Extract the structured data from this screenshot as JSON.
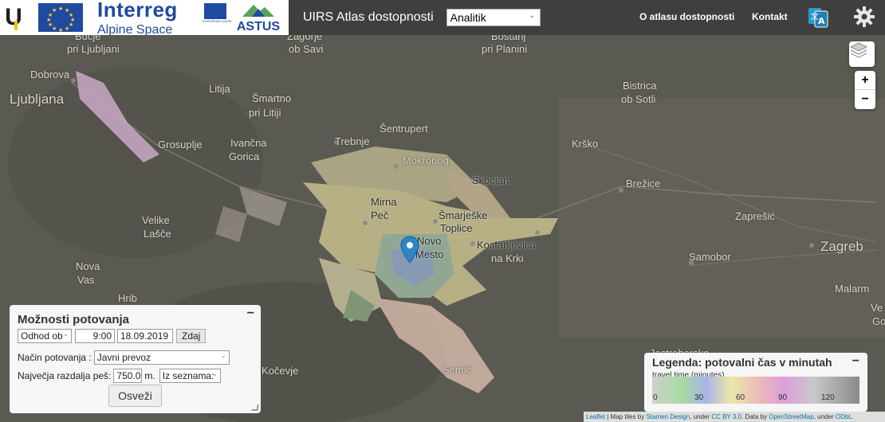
{
  "header": {
    "logo_letter": "U",
    "interreg_title": "Interreg",
    "interreg_subtitle": "Alpine Space",
    "eu_small_text": "EUROPEAN UNION",
    "astus_label": "ASTUS",
    "app_title": "UIRS Atlas dostopnosti",
    "mode_value": "Analitik",
    "nav_about": "O atlasu dostopnosti",
    "nav_contact": "Kontakt",
    "icons": [
      "translate-icon",
      "gear-icon"
    ]
  },
  "map": {
    "places": [
      {
        "name": "Bučje",
        "dark": false
      },
      {
        "name": "pri Ljubljani",
        "dark": false
      },
      {
        "name": "Zagorje",
        "dark": false
      },
      {
        "name": "ob Savi",
        "dark": false
      },
      {
        "name": "Boštanj",
        "dark": false
      },
      {
        "name": "pri Planini",
        "dark": false
      },
      {
        "name": "Dobrova",
        "dark": false
      },
      {
        "name": "Ljubljana",
        "dark": false
      },
      {
        "name": "Litija",
        "dark": false
      },
      {
        "name": "Šmartno",
        "dark": false
      },
      {
        "name": "pri Litiji",
        "dark": false
      },
      {
        "name": "Bistrica",
        "dark": false
      },
      {
        "name": "ob Sotli",
        "dark": false
      },
      {
        "name": "Šentrupert",
        "dark": false
      },
      {
        "name": "Grosuplje",
        "dark": false
      },
      {
        "name": "Ivančna",
        "dark": false
      },
      {
        "name": "Gorica",
        "dark": false
      },
      {
        "name": "Trebnje",
        "dark": false
      },
      {
        "name": "Mokronog",
        "dark": false
      },
      {
        "name": "Krško",
        "dark": false
      },
      {
        "name": "Škocjan",
        "dark": true
      },
      {
        "name": "Brežice",
        "dark": false
      },
      {
        "name": "Mirna",
        "dark": true
      },
      {
        "name": "Peč",
        "dark": true
      },
      {
        "name": "Šmarješke",
        "dark": true
      },
      {
        "name": "Toplice",
        "dark": true
      },
      {
        "name": "Velike",
        "dark": false
      },
      {
        "name": "Lašče",
        "dark": false
      },
      {
        "name": "Zaprešić",
        "dark": false
      },
      {
        "name": "Novo",
        "dark": true
      },
      {
        "name": "Mesto",
        "dark": true
      },
      {
        "name": "Kostanjevica",
        "dark": true
      },
      {
        "name": "na Krki",
        "dark": false
      },
      {
        "name": "Zagreb",
        "dark": false
      },
      {
        "name": "Samobor",
        "dark": false
      },
      {
        "name": "Nova",
        "dark": false
      },
      {
        "name": "Vas",
        "dark": false
      },
      {
        "name": "Malarm",
        "dark": false
      },
      {
        "name": "Hrib",
        "dark": false
      },
      {
        "name": "Ve",
        "dark": false
      },
      {
        "name": "Go",
        "dark": false
      },
      {
        "name": "Kočevje",
        "dark": false
      },
      {
        "name": "Semič",
        "dark": false
      },
      {
        "name": "Jastrebarsko",
        "dark": false
      }
    ],
    "marker_location": "Novo Mesto",
    "controls": [
      "layers-icon",
      "zoom-in",
      "zoom-out"
    ],
    "zoom_in_label": "+",
    "zoom_out_label": "−"
  },
  "options_panel": {
    "title": "Možnosti potovanja",
    "minimize": "−",
    "departure_mode": "Odhod ob",
    "time": "9:00",
    "date": "18.09.2019",
    "now_button": "Zdaj",
    "travel_mode_label": "Način potovanja :",
    "travel_mode_value": "Javni prevoz",
    "walk_label": "Največja razdalja peš:",
    "walk_value": "750.00",
    "walk_unit": "m.",
    "walk_select": "Iz seznama:",
    "refresh_button": "Osveži"
  },
  "legend": {
    "title": "Legenda: potovalni čas v minutah",
    "minimize": "−",
    "subtitle": "travel time (minutes)",
    "ticks": [
      "0",
      "30",
      "60",
      "90",
      "120"
    ],
    "colors": [
      "#c4c4c4",
      "#a8d8a0",
      "#a8b4e8",
      "#e8e4a0",
      "#e8b0b0",
      "#d8a0d8",
      "#c0c0c0",
      "#8a8a8a"
    ]
  },
  "attribution": {
    "leaflet": "Leaflet",
    "text1": " | Map tiles by ",
    "stamen": "Stamen Design",
    "text2": ", under ",
    "ccby": "CC BY 3.0",
    "text3": ". Data by ",
    "osm": "OpenStreetMap",
    "text4": ", under ",
    "odbl": "ODbL."
  }
}
